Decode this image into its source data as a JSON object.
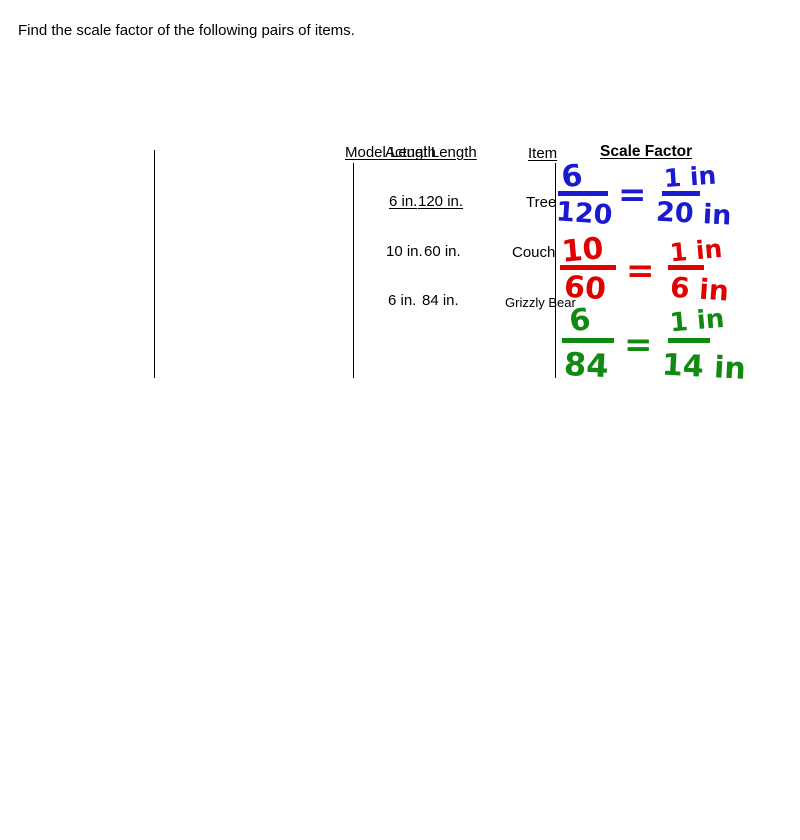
{
  "slide": {
    "title": "Find the scale factor of the following pairs of items.",
    "background_color": "#ffffff",
    "text_color": "#000000"
  },
  "table": {
    "headers": {
      "model_length": "Model Length",
      "actual_length": "Actual Length",
      "item": "Item",
      "scale_factor": "Scale Factor"
    },
    "rows": [
      {
        "model_length": "6 in.",
        "actual_length": "120 in.",
        "item": "Tree"
      },
      {
        "model_length": "10 in.",
        "actual_length": "60 in.",
        "item": "Couch"
      },
      {
        "model_length": "6 in.",
        "actual_length": "84 in.",
        "item": "Grizzly Bear"
      }
    ]
  },
  "annotations": [
    {
      "row": "Tree",
      "color": "#1a1ad0",
      "color_name": "blue",
      "numerator": "6",
      "denominator": "120",
      "equals": "=",
      "answer_numerator": "1 in",
      "answer_denominator": "20 in",
      "reading": "6/120 = 1 in/20 in"
    },
    {
      "row": "Couch",
      "color": "#e00000",
      "color_name": "red",
      "numerator": "10",
      "denominator": "60",
      "equals": "=",
      "answer_numerator": "1 in",
      "answer_denominator": "6 in",
      "reading": "10/60 = 1 in/6 in"
    },
    {
      "row": "Grizzly Bear",
      "color": "#118a11",
      "color_name": "green",
      "numerator": "6",
      "denominator": "84",
      "equals": "=",
      "answer_numerator": "1 in",
      "answer_denominator": "14 in",
      "reading": "6/84 = 1 in/14 in"
    }
  ]
}
